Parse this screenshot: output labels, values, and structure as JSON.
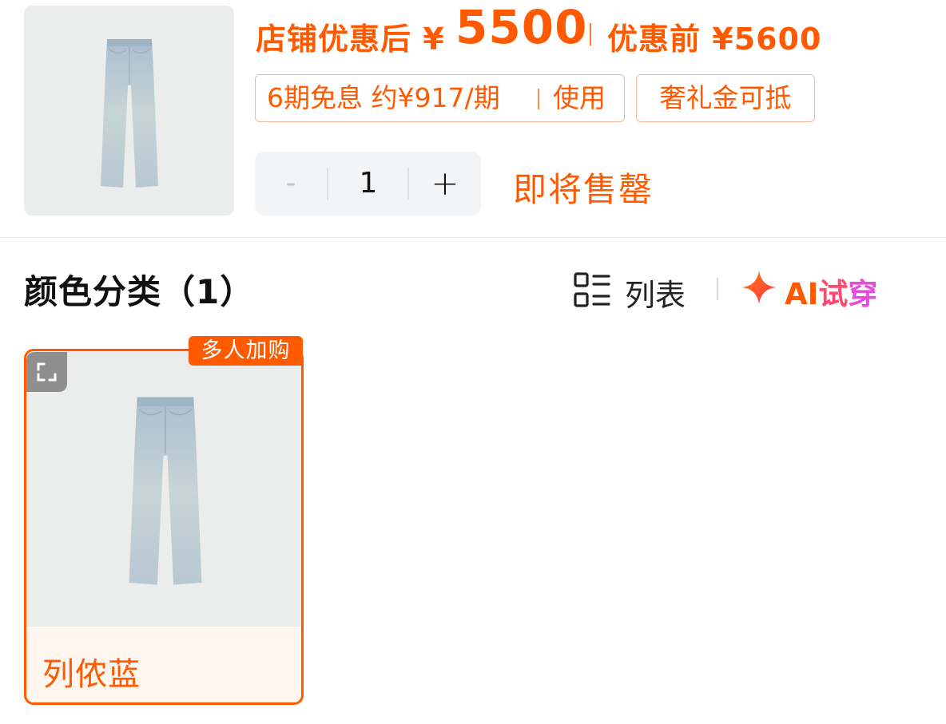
{
  "product": {
    "image_icon": "jeans-image"
  },
  "price": {
    "after_label": "店铺优惠后",
    "currency": "¥",
    "after_amount": "5500",
    "before_label": "优惠前",
    "before_amount": "5600"
  },
  "tags": {
    "installment_text": "6期免息 约¥917/期",
    "installment_action": "使用",
    "gift_text": "奢礼金可抵"
  },
  "quantity": {
    "minus_label": "-",
    "value": "1",
    "plus_label": "+"
  },
  "stock_status": "即将售罄",
  "section": {
    "title": "颜色分类（1）",
    "list_toggle_label": "列表",
    "list_icon": "list-view-icon",
    "ai_try_label_ai": "AI",
    "ai_try_label_shi": "试",
    "ai_try_label_chuan": "穿",
    "ai_icon": "sparkle-icon"
  },
  "variants": [
    {
      "name": "列侬蓝",
      "badge": "多人加购",
      "expand_icon": "expand-icon",
      "selected": true
    }
  ],
  "colors": {
    "accent": "#ff5a00",
    "tag_border": "#f6b896",
    "stepper_bg": "#f3f4f6",
    "image_bg": "#ebedec"
  }
}
